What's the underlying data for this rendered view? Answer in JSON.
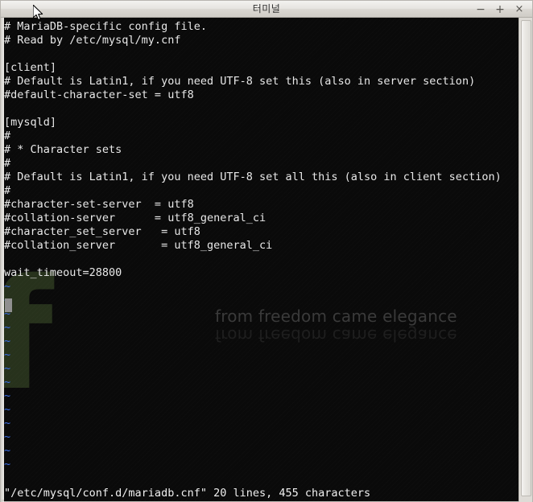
{
  "window": {
    "title": "터미널",
    "buttons": {
      "minimize": "−",
      "maximize": "+",
      "close": "×"
    }
  },
  "terminal": {
    "background_color": "#0a0a0a",
    "foreground_color": "#e8e8e8",
    "tilde_color": "#3a6ee8",
    "cursor_color": "#8f8f8f",
    "watermark": {
      "logo_glyph": "f",
      "logo_color": "#2d3a20",
      "slogan": "from freedom came elegance"
    },
    "lines": [
      "# MariaDB-specific config file.",
      "# Read by /etc/mysql/my.cnf",
      "",
      "[client]",
      "# Default is Latin1, if you need UTF-8 set this (also in server section)",
      "#default-character-set = utf8",
      "",
      "[mysqld]",
      "#",
      "# * Character sets",
      "#",
      "# Default is Latin1, if you need UTF-8 set all this (also in client section)",
      "#",
      "#character-set-server  = utf8",
      "#collation-server      = utf8_general_ci",
      "#character_set_server   = utf8",
      "#collation_server       = utf8_general_ci",
      "",
      "wait_timeout=28800"
    ],
    "empty_markers": [
      "~",
      "~",
      "~",
      "~",
      "~",
      "~",
      "~",
      "~",
      "~",
      "~",
      "~",
      "~",
      "~",
      "~"
    ],
    "status_line": "\"/etc/mysql/conf.d/mariadb.cnf\" 20 lines, 455 characters"
  },
  "scrollbar": {
    "orientation": "vertical",
    "thumb_position": "full"
  }
}
